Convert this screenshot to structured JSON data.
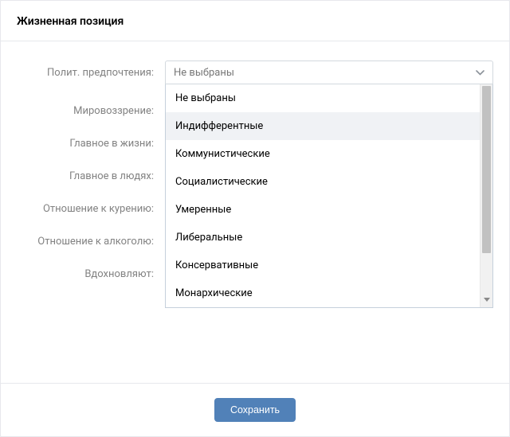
{
  "header": {
    "title": "Жизненная позиция"
  },
  "form": {
    "rows": [
      {
        "label": "Полит. предпочтения:"
      },
      {
        "label": "Мировоззрение:"
      },
      {
        "label": "Главное в жизни:"
      },
      {
        "label": "Главное в людях:"
      },
      {
        "label": "Отношение к курению:"
      },
      {
        "label": "Отношение к алкоголю:"
      },
      {
        "label": "Вдохновляют:"
      }
    ],
    "political_select": {
      "value": "Не выбраны",
      "options": [
        "Не выбраны",
        "Индифферентные",
        "Коммунистические",
        "Социалистические",
        "Умеренные",
        "Либеральные",
        "Консервативные",
        "Монархические"
      ],
      "hovered_index": 1
    }
  },
  "footer": {
    "save_label": "Сохранить"
  }
}
